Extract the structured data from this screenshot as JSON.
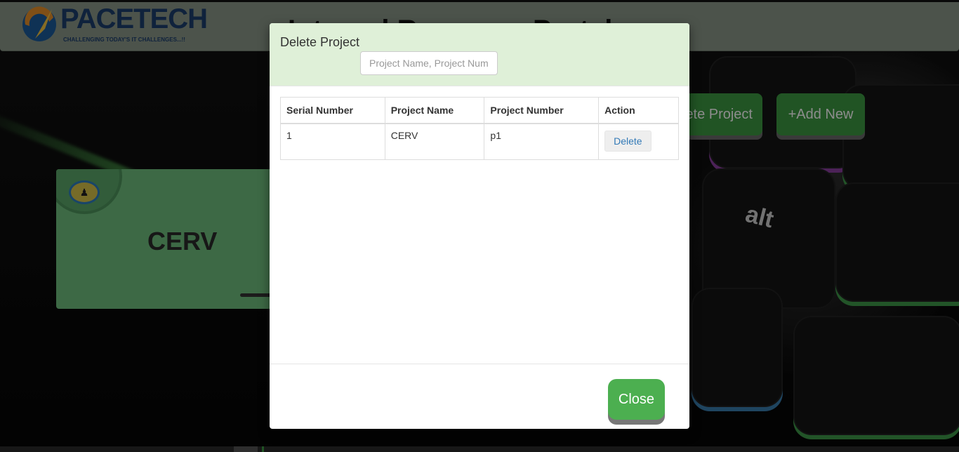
{
  "header": {
    "logo_text": "PACETECH",
    "logo_tagline": "CHALLENGING TODAY'S IT CHALLENGES...!!",
    "title": "Internal Resource Portal"
  },
  "toolbar": {
    "delete_project_label": "Delete Project",
    "add_new_label": "+Add New"
  },
  "project_card": {
    "title": "CERV"
  },
  "modal": {
    "title": "Delete Project",
    "search": {
      "placeholder": "Project Name, Project Number",
      "value": ""
    },
    "table": {
      "columns": [
        "Serial Number",
        "Project Name",
        "Project Number",
        "Action"
      ],
      "rows": [
        {
          "serial": "1",
          "name": "CERV",
          "number": "p1",
          "action_label": "Delete"
        }
      ]
    },
    "close_label": "Close"
  },
  "colors": {
    "header_bg": "#8b9789",
    "modal_header_bg": "#dff0d8",
    "primary_green": "#4caf50",
    "link_blue": "#337ab7"
  },
  "icons": {
    "keyboard_key_label": "alt",
    "add_icon": "plus-icon"
  }
}
